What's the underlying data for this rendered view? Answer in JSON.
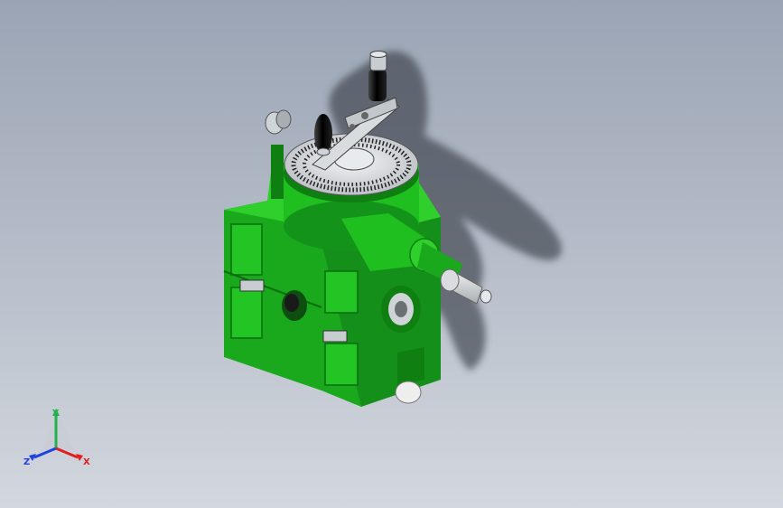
{
  "viewport": {
    "background_top": "#9aa4b4",
    "background_bottom": "#d3d7de"
  },
  "model": {
    "body_color": "#1fbf1f",
    "body_dark": "#0f7f12",
    "body_light": "#3fdc3a",
    "metal_color": "#cfd4d8",
    "knob_color": "#111111",
    "shadow_color": "#3a3f4a"
  },
  "triad": {
    "x_label": "X",
    "y_label": "Y",
    "z_label": "Z",
    "x_color": "#e02020",
    "y_color": "#22b14c",
    "z_color": "#2040e0"
  }
}
